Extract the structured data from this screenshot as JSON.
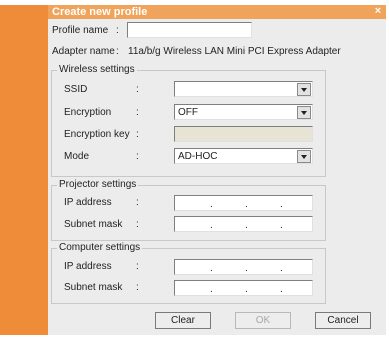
{
  "window": {
    "title": "Create new profile",
    "close": "×"
  },
  "profile": {
    "label": "Profile name",
    "sep": ":",
    "value": ""
  },
  "adapter": {
    "label": "Adapter name",
    "sep": ":",
    "value": "11a/b/g Wireless LAN Mini PCI Express Adapter"
  },
  "wireless": {
    "title": "Wireless settings",
    "ssid_label": "SSID",
    "ssid_value": "",
    "encryption_label": "Encryption",
    "encryption_value": "OFF",
    "key_label": "Encryption key",
    "key_value": "",
    "mode_label": "Mode",
    "mode_value": "AD-HOC",
    "sep": ":"
  },
  "projector": {
    "title": "Projector settings",
    "ip_label": "IP address",
    "mask_label": "Subnet mask",
    "sep": ":",
    "dot": "."
  },
  "computer": {
    "title": "Computer settings",
    "ip_label": "IP address",
    "mask_label": "Subnet mask",
    "sep": ":",
    "dot": "."
  },
  "buttons": {
    "clear": "Clear",
    "ok": "OK",
    "cancel": "Cancel"
  },
  "colors": {
    "accent": "#ee8c3a",
    "titlebar": "#f0a35a",
    "dialog_bg": "#ececec",
    "disabled_field": "#e7e4d5"
  }
}
